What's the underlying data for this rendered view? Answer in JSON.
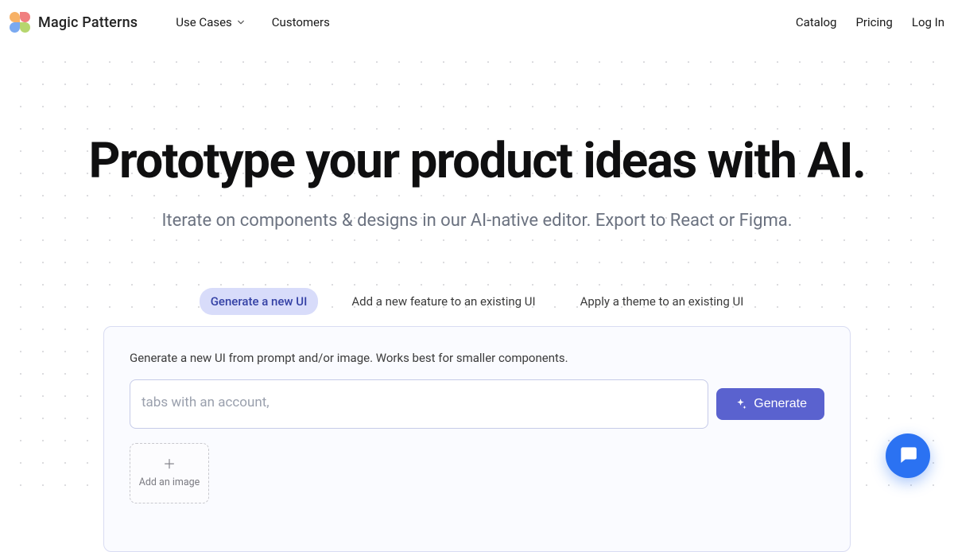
{
  "brand": {
    "name": "Magic Patterns"
  },
  "nav": {
    "use_cases": "Use Cases",
    "customers": "Customers",
    "catalog": "Catalog",
    "pricing": "Pricing",
    "login": "Log In"
  },
  "hero": {
    "title": "Prototype your product ideas with AI.",
    "subtitle": "Iterate on components & designs in our AI-native editor. Export to React or Figma."
  },
  "tabs": {
    "generate": "Generate a new UI",
    "add_feature": "Add a new feature to an existing UI",
    "apply_theme": "Apply a theme to an existing UI"
  },
  "panel": {
    "description": "Generate a new UI from prompt and/or image. Works best for smaller components.",
    "prompt_placeholder": "tabs with an account,",
    "generate_label": "Generate",
    "add_image_label": "Add an image"
  }
}
